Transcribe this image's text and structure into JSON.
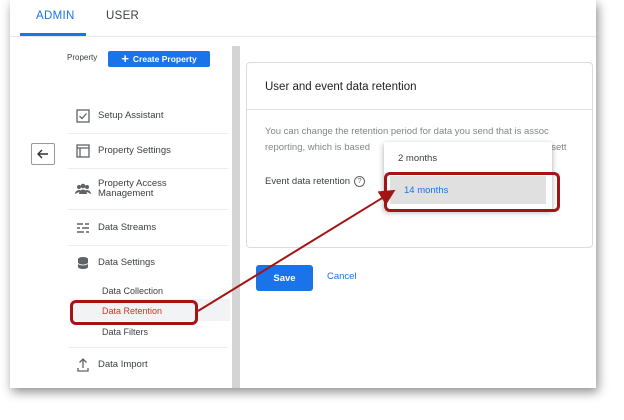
{
  "tabs": {
    "admin": "ADMIN",
    "user": "USER"
  },
  "property": {
    "label": "Property",
    "create_button": "Create Property"
  },
  "nav": {
    "items": [
      {
        "label": "Setup Assistant",
        "icon": "checkbox-icon"
      },
      {
        "label": "Property Settings",
        "icon": "window-icon"
      },
      {
        "label": "Property Access Management",
        "icon": "group-icon"
      },
      {
        "label": "Data Streams",
        "icon": "streams-icon"
      },
      {
        "label": "Data Settings",
        "icon": "database-icon"
      }
    ],
    "sub_items": [
      "Data Collection",
      "Data Retention",
      "Data Filters"
    ],
    "import": {
      "label": "Data Import",
      "icon": "upload-icon"
    }
  },
  "card": {
    "title": "User and event data retention",
    "desc_line1": "You can change the retention period for data you send that is assoc",
    "desc_line2": "reporting, which is based",
    "desc_line2_tail": "these sett",
    "field_label": "Event data retention",
    "help_glyph": "?"
  },
  "dropdown": {
    "options": [
      "2 months",
      "14 months"
    ],
    "selected": "14 months"
  },
  "actions": {
    "save": "Save",
    "cancel": "Cancel"
  },
  "colors": {
    "accent": "#1a73e8",
    "callout": "#a31515",
    "active_nav": "#d93025"
  }
}
